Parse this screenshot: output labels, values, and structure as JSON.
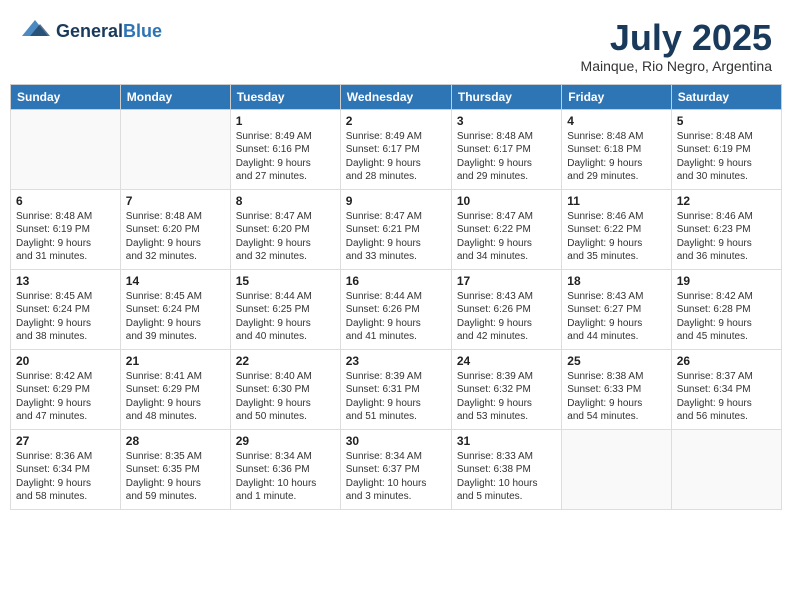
{
  "header": {
    "logo_general": "General",
    "logo_blue": "Blue",
    "month_title": "July 2025",
    "location": "Mainque, Rio Negro, Argentina"
  },
  "days_of_week": [
    "Sunday",
    "Monday",
    "Tuesday",
    "Wednesday",
    "Thursday",
    "Friday",
    "Saturday"
  ],
  "weeks": [
    [
      {
        "day": "",
        "content": ""
      },
      {
        "day": "",
        "content": ""
      },
      {
        "day": "1",
        "content": "Sunrise: 8:49 AM\nSunset: 6:16 PM\nDaylight: 9 hours\nand 27 minutes."
      },
      {
        "day": "2",
        "content": "Sunrise: 8:49 AM\nSunset: 6:17 PM\nDaylight: 9 hours\nand 28 minutes."
      },
      {
        "day": "3",
        "content": "Sunrise: 8:48 AM\nSunset: 6:17 PM\nDaylight: 9 hours\nand 29 minutes."
      },
      {
        "day": "4",
        "content": "Sunrise: 8:48 AM\nSunset: 6:18 PM\nDaylight: 9 hours\nand 29 minutes."
      },
      {
        "day": "5",
        "content": "Sunrise: 8:48 AM\nSunset: 6:19 PM\nDaylight: 9 hours\nand 30 minutes."
      }
    ],
    [
      {
        "day": "6",
        "content": "Sunrise: 8:48 AM\nSunset: 6:19 PM\nDaylight: 9 hours\nand 31 minutes."
      },
      {
        "day": "7",
        "content": "Sunrise: 8:48 AM\nSunset: 6:20 PM\nDaylight: 9 hours\nand 32 minutes."
      },
      {
        "day": "8",
        "content": "Sunrise: 8:47 AM\nSunset: 6:20 PM\nDaylight: 9 hours\nand 32 minutes."
      },
      {
        "day": "9",
        "content": "Sunrise: 8:47 AM\nSunset: 6:21 PM\nDaylight: 9 hours\nand 33 minutes."
      },
      {
        "day": "10",
        "content": "Sunrise: 8:47 AM\nSunset: 6:22 PM\nDaylight: 9 hours\nand 34 minutes."
      },
      {
        "day": "11",
        "content": "Sunrise: 8:46 AM\nSunset: 6:22 PM\nDaylight: 9 hours\nand 35 minutes."
      },
      {
        "day": "12",
        "content": "Sunrise: 8:46 AM\nSunset: 6:23 PM\nDaylight: 9 hours\nand 36 minutes."
      }
    ],
    [
      {
        "day": "13",
        "content": "Sunrise: 8:45 AM\nSunset: 6:24 PM\nDaylight: 9 hours\nand 38 minutes."
      },
      {
        "day": "14",
        "content": "Sunrise: 8:45 AM\nSunset: 6:24 PM\nDaylight: 9 hours\nand 39 minutes."
      },
      {
        "day": "15",
        "content": "Sunrise: 8:44 AM\nSunset: 6:25 PM\nDaylight: 9 hours\nand 40 minutes."
      },
      {
        "day": "16",
        "content": "Sunrise: 8:44 AM\nSunset: 6:26 PM\nDaylight: 9 hours\nand 41 minutes."
      },
      {
        "day": "17",
        "content": "Sunrise: 8:43 AM\nSunset: 6:26 PM\nDaylight: 9 hours\nand 42 minutes."
      },
      {
        "day": "18",
        "content": "Sunrise: 8:43 AM\nSunset: 6:27 PM\nDaylight: 9 hours\nand 44 minutes."
      },
      {
        "day": "19",
        "content": "Sunrise: 8:42 AM\nSunset: 6:28 PM\nDaylight: 9 hours\nand 45 minutes."
      }
    ],
    [
      {
        "day": "20",
        "content": "Sunrise: 8:42 AM\nSunset: 6:29 PM\nDaylight: 9 hours\nand 47 minutes."
      },
      {
        "day": "21",
        "content": "Sunrise: 8:41 AM\nSunset: 6:29 PM\nDaylight: 9 hours\nand 48 minutes."
      },
      {
        "day": "22",
        "content": "Sunrise: 8:40 AM\nSunset: 6:30 PM\nDaylight: 9 hours\nand 50 minutes."
      },
      {
        "day": "23",
        "content": "Sunrise: 8:39 AM\nSunset: 6:31 PM\nDaylight: 9 hours\nand 51 minutes."
      },
      {
        "day": "24",
        "content": "Sunrise: 8:39 AM\nSunset: 6:32 PM\nDaylight: 9 hours\nand 53 minutes."
      },
      {
        "day": "25",
        "content": "Sunrise: 8:38 AM\nSunset: 6:33 PM\nDaylight: 9 hours\nand 54 minutes."
      },
      {
        "day": "26",
        "content": "Sunrise: 8:37 AM\nSunset: 6:34 PM\nDaylight: 9 hours\nand 56 minutes."
      }
    ],
    [
      {
        "day": "27",
        "content": "Sunrise: 8:36 AM\nSunset: 6:34 PM\nDaylight: 9 hours\nand 58 minutes."
      },
      {
        "day": "28",
        "content": "Sunrise: 8:35 AM\nSunset: 6:35 PM\nDaylight: 9 hours\nand 59 minutes."
      },
      {
        "day": "29",
        "content": "Sunrise: 8:34 AM\nSunset: 6:36 PM\nDaylight: 10 hours\nand 1 minute."
      },
      {
        "day": "30",
        "content": "Sunrise: 8:34 AM\nSunset: 6:37 PM\nDaylight: 10 hours\nand 3 minutes."
      },
      {
        "day": "31",
        "content": "Sunrise: 8:33 AM\nSunset: 6:38 PM\nDaylight: 10 hours\nand 5 minutes."
      },
      {
        "day": "",
        "content": ""
      },
      {
        "day": "",
        "content": ""
      }
    ]
  ]
}
